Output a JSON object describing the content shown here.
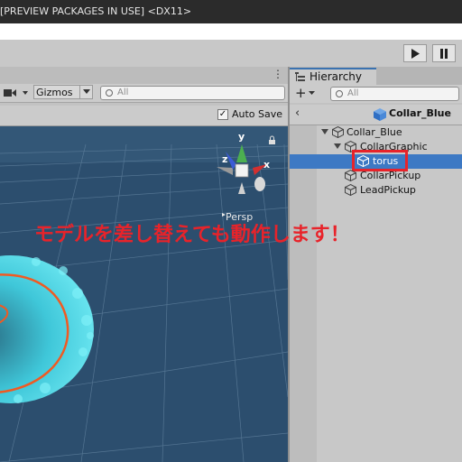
{
  "window": {
    "title": "[PREVIEW PACKAGES IN USE] <DX11>"
  },
  "toolbar": {
    "play_icon": "play-icon",
    "pause_icon": "pause-icon"
  },
  "scene": {
    "gizmos_label": "Gizmos",
    "search_placeholder": "All",
    "auto_save_label": "Auto Save",
    "auto_save_checked": true,
    "persp_label": "Persp",
    "axes": {
      "y": "y",
      "x": "x",
      "z": "z"
    }
  },
  "hierarchy": {
    "tab_label": "Hierarchy",
    "search_placeholder": "All",
    "breadcrumb": "Collar_Blue",
    "items": [
      {
        "label": "Collar_Blue",
        "depth": 0,
        "expanded": true
      },
      {
        "label": "CollarGraphic",
        "depth": 1,
        "expanded": true
      },
      {
        "label": "torus",
        "depth": 2,
        "selected": true
      },
      {
        "label": "CollarPickup",
        "depth": 1
      },
      {
        "label": "LeadPickup",
        "depth": 1
      }
    ]
  },
  "annotation": {
    "text": "モデルを差し替えても動作します！",
    "color": "#e8232a"
  },
  "colors": {
    "selection": "#3d79c4",
    "viewport_bg": "#2c4e6e",
    "fur": "#5ee0ee",
    "ring": "#f05a22"
  }
}
